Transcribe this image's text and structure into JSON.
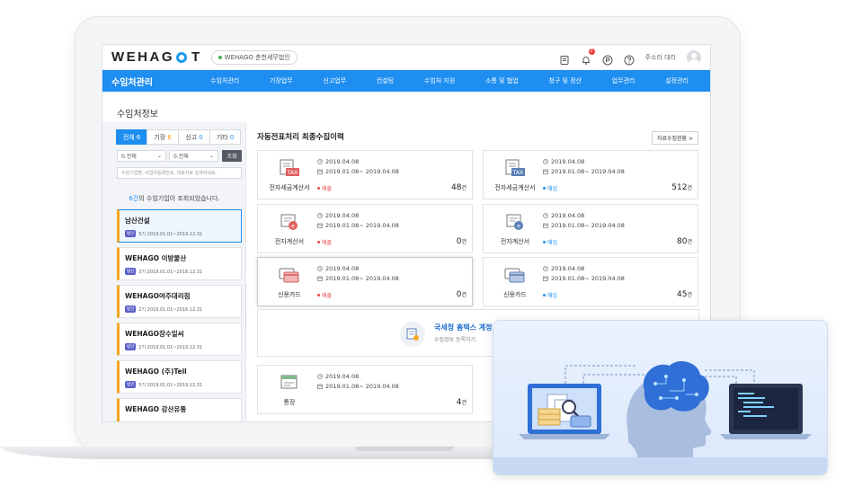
{
  "header": {
    "logo": "WEHAGO T",
    "logo_left": "WEHAG",
    "logo_right": "T",
    "company": "WEHAGO 춘천세무법인",
    "user": "주소라 대리",
    "notification_count": "2"
  },
  "nav": {
    "title": "수임처관리",
    "items": [
      "수임처관리",
      "기장업무",
      "신고업무",
      "컨설팅",
      "수임처 지원",
      "소통 및 협업",
      "청구 및 정산",
      "업무관리",
      "설정관리"
    ]
  },
  "page_title": "수임처정보",
  "filters": {
    "tabs": [
      {
        "label": "전체",
        "count": "6"
      },
      {
        "label": "기장",
        "count": "6"
      },
      {
        "label": "신고",
        "count": "0"
      },
      {
        "label": "기타",
        "count": "0"
      }
    ],
    "select1": "0.전체",
    "select2": "0.전체",
    "search_button": "조회",
    "search_placeholder": "수임기업명, 사업자등록번호, 대표자로 검색하세요."
  },
  "result": {
    "count": "6건",
    "message": "의 수임기업이 조회되었습니다."
  },
  "companies": [
    {
      "name": "남산건설",
      "tag": "법인",
      "meta": "5기 2019.01.01~2019.12.31"
    },
    {
      "name": "WEHAGO 이방물산",
      "tag": "법인",
      "meta": "3기 2018.01.01~2018.12.31"
    },
    {
      "name": "WEHAGO여주대리점",
      "tag": "법인",
      "meta": "2기 2016.01.01~2016.12.31"
    },
    {
      "name": "WEHAGO장수일씨",
      "tag": "법인",
      "meta": "2기 2019.01.01~2019.12.31"
    },
    {
      "name": "WEHAGO (주)Tell",
      "tag": "법인",
      "meta": "5기 2019.01.01~2019.12.31"
    },
    {
      "name": "WEHAGO 강산유통",
      "tag": "",
      "meta": ""
    }
  ],
  "right": {
    "title": "자동전표처리 최종수집이력",
    "status_button": "자료수집현황 >",
    "cards": [
      {
        "label": "전자세금계산서",
        "date1": "2019.04.08",
        "date2": "2019.01.08~ 2019.04.08",
        "kind": "매출",
        "count": "48",
        "unit": "건"
      },
      {
        "label": "전자세금계산서",
        "date1": "2019.04.08",
        "date2": "2019.01.08~ 2019.04.08",
        "kind": "매입",
        "count": "512",
        "unit": "건"
      },
      {
        "label": "전자계산서",
        "date1": "2019.04.08",
        "date2": "2019.01.08~ 2019.04.08",
        "kind": "매출",
        "count": "0",
        "unit": "건"
      },
      {
        "label": "전자계산서",
        "date1": "2019.04.08",
        "date2": "2019.01.08~ 2019.04.08",
        "kind": "매입",
        "count": "80",
        "unit": "건"
      },
      {
        "label": "신용카드",
        "date1": "2019.04.08",
        "date2": "2019.01.08~ 2019.04.08",
        "kind": "매출",
        "count": "0",
        "unit": "건"
      },
      {
        "label": "신용카드",
        "date1": "2019.04.08",
        "date2": "2019.01.08~ 2019.04.08",
        "kind": "매입",
        "count": "45",
        "unit": "건"
      },
      {
        "label": "통장",
        "date1": "2019.04.08",
        "date2": "2019.01.08~ 2019.04.08",
        "kind": "",
        "count": "4",
        "unit": "건"
      }
    ],
    "nts": {
      "title": "국세청 홈택스 계정",
      "subtitle": "수집정보 등록하기"
    }
  },
  "colors": {
    "primary": "#1e8ef0",
    "sale": "#e84a4a",
    "accent": "#f5a623"
  }
}
